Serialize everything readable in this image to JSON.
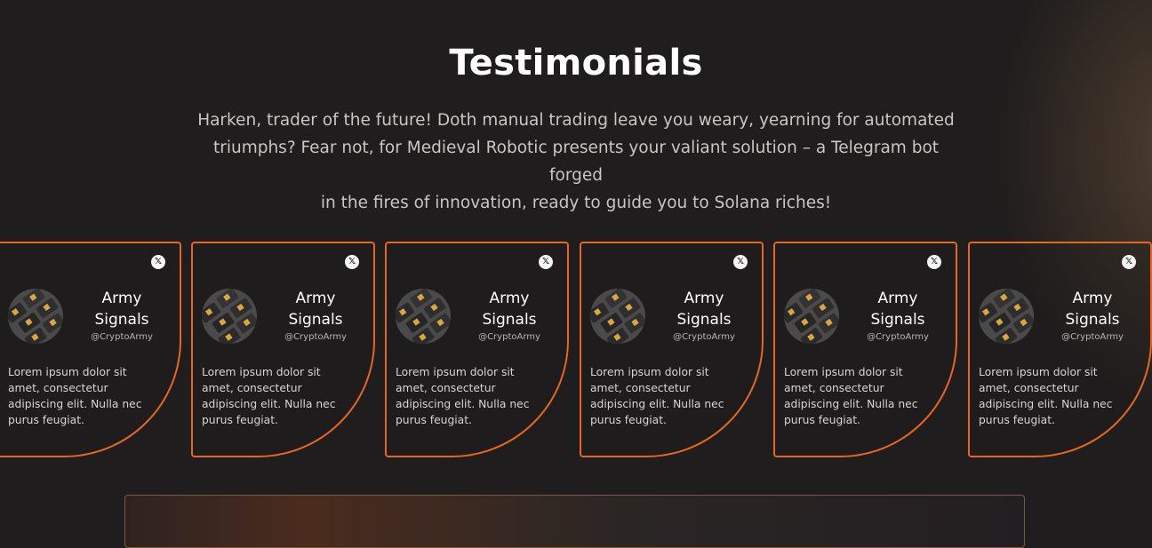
{
  "section": {
    "title": "Testimonials",
    "subtitle_lines": [
      "Harken, trader of the future! Doth manual trading leave you weary, yearning for automated",
      "triumphs? Fear not, for Medieval Robotic presents your valiant solution – a Telegram bot forged",
      "in the fires of innovation, ready to guide you to Solana riches!"
    ]
  },
  "testimonials": [
    {
      "name_line1": "Army",
      "name_line2": "Signals",
      "handle": "@CryptoArmy",
      "text": "Lorem ipsum dolor sit amet, consectetur adipiscing elit. Nulla nec purus feugiat.",
      "icon": "x-logo-icon"
    },
    {
      "name_line1": "Army",
      "name_line2": "Signals",
      "handle": "@CryptoArmy",
      "text": "Lorem ipsum dolor sit amet, consectetur adipiscing elit. Nulla nec purus feugiat.",
      "icon": "x-logo-icon"
    },
    {
      "name_line1": "Army",
      "name_line2": "Signals",
      "handle": "@CryptoArmy",
      "text": "Lorem ipsum dolor sit amet, consectetur adipiscing elit. Nulla nec purus feugiat.",
      "icon": "x-logo-icon"
    },
    {
      "name_line1": "Army",
      "name_line2": "Signals",
      "handle": "@CryptoArmy",
      "text": "Lorem ipsum dolor sit amet, consectetur adipiscing elit. Nulla nec purus feugiat.",
      "icon": "x-logo-icon"
    },
    {
      "name_line1": "Army",
      "name_line2": "Signals",
      "handle": "@CryptoArmy",
      "text": "Lorem ipsum dolor sit amet, consectetur adipiscing elit. Nulla nec purus feugiat.",
      "icon": "x-logo-icon"
    },
    {
      "name_line1": "Army",
      "name_line2": "Signals",
      "handle": "@CryptoArmy",
      "text": "Lorem ipsum dolor sit amet, consectetur adipiscing elit. Nulla nec purus feugiat.",
      "icon": "x-logo-icon"
    }
  ],
  "colors": {
    "background": "#1f1d1d",
    "card_border": "#e8671c",
    "accent_glow": "#78583e"
  }
}
